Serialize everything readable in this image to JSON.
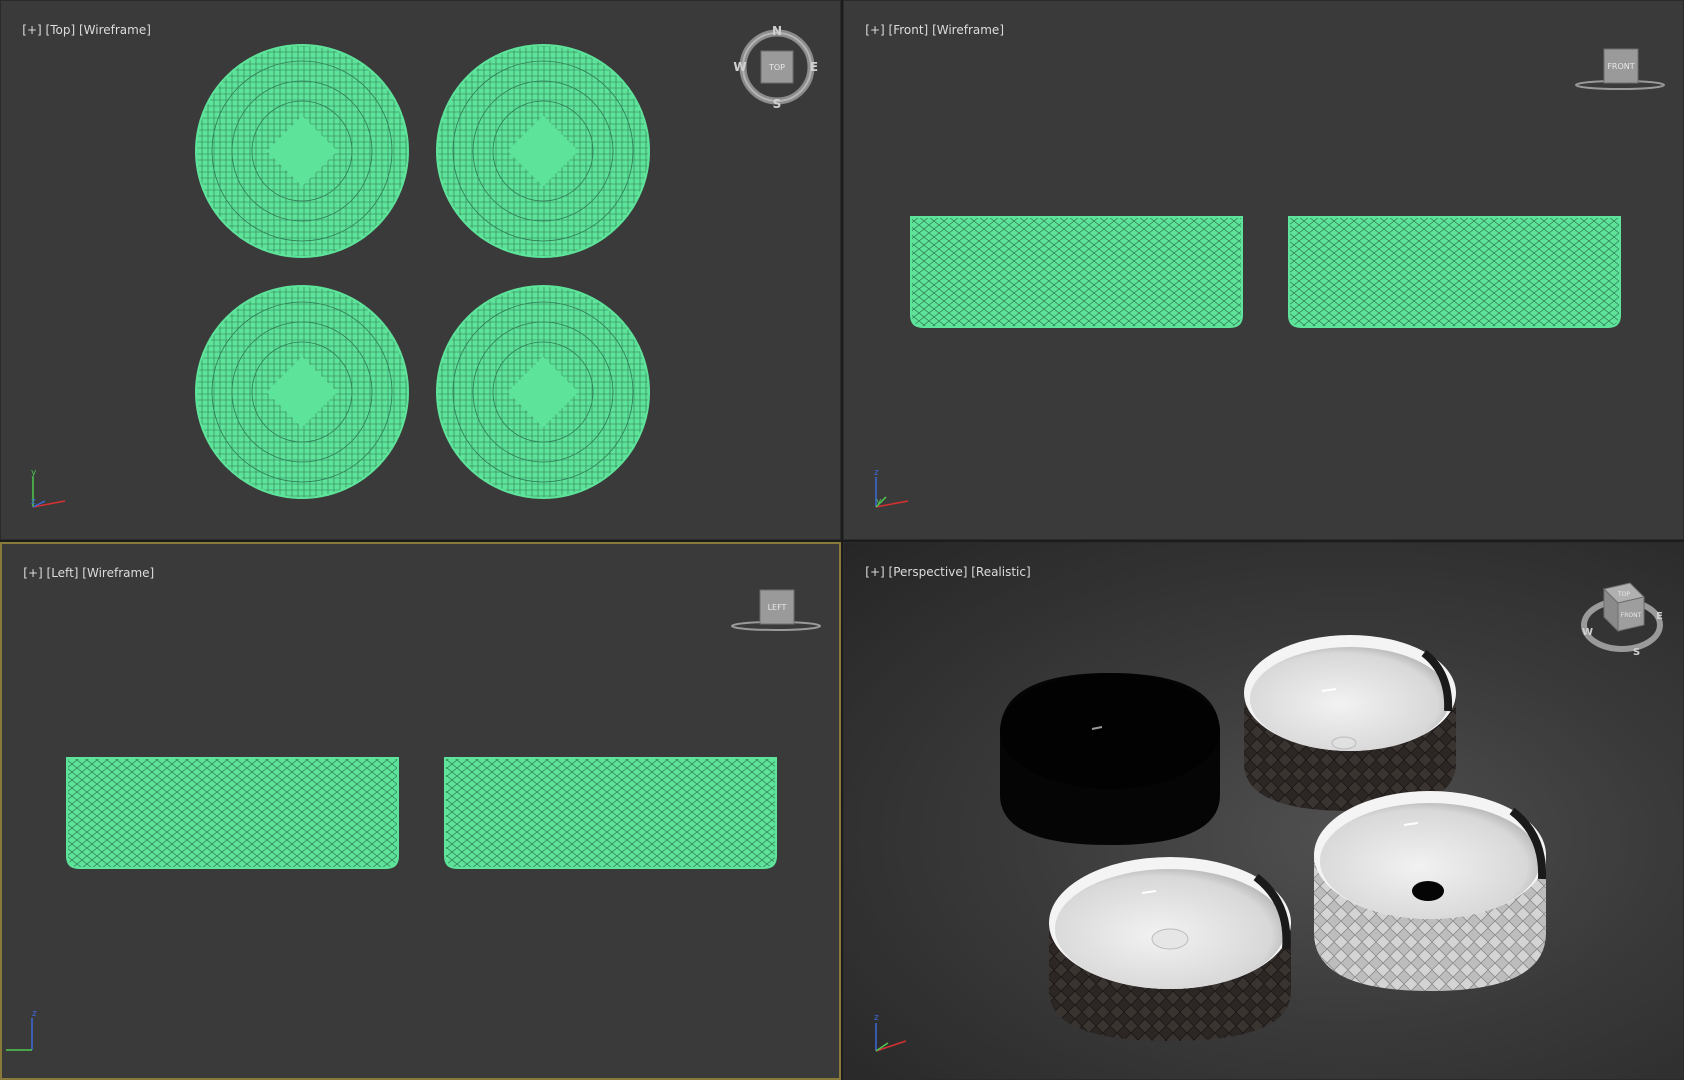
{
  "viewports": {
    "top": {
      "label_plus": "[+]",
      "label_view": "[Top]",
      "label_mode": "[Wireframe]",
      "gizmo": {
        "n": "N",
        "s": "S",
        "e": "E",
        "w": "W",
        "cube": "TOP"
      },
      "axes": {
        "a": "y",
        "b": "z"
      }
    },
    "front": {
      "label_plus": "[+]",
      "label_view": "[Front]",
      "label_mode": "[Wireframe]",
      "gizmo": {
        "cube": "FRONT"
      },
      "axes": {
        "a": "z",
        "b": "y"
      }
    },
    "left": {
      "label_plus": "[+]",
      "label_view": "[Left]",
      "label_mode": "[Wireframe]",
      "gizmo": {
        "cube": "LEFT"
      },
      "axes": {
        "a": "z"
      }
    },
    "perspective": {
      "label_plus": "[+]",
      "label_view": "[Perspective]",
      "label_mode": "[Realistic]",
      "gizmo": {
        "cube_top": "TOP",
        "cube_front": "FRONT",
        "e": "E",
        "w": "W",
        "s": "S"
      },
      "axes": {
        "a": "z"
      }
    }
  },
  "colors": {
    "wireframe": "#5ee39a",
    "viewport_bg": "#3a3a3a",
    "active_border": "#8a7a3a",
    "label_text": "#dcdcdc"
  }
}
